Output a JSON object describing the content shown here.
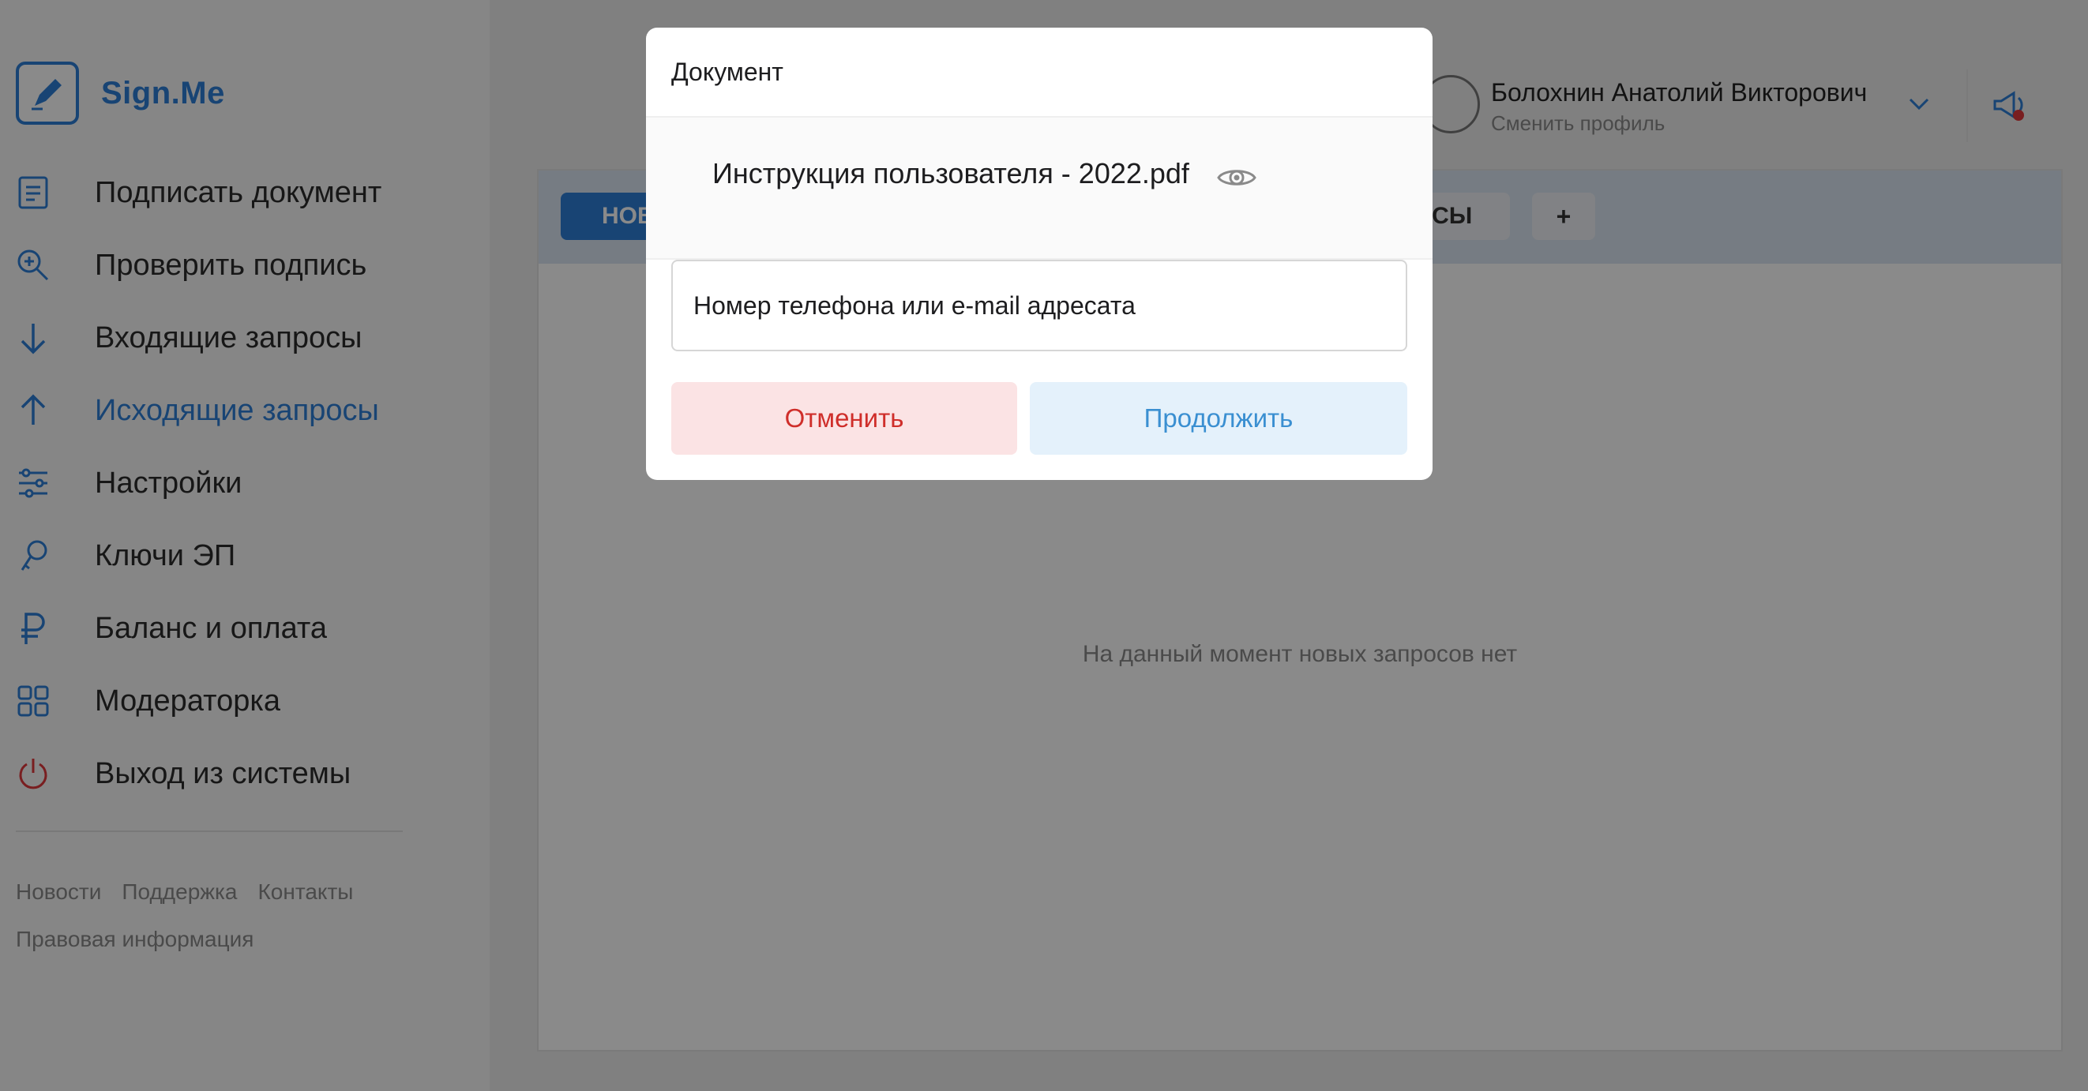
{
  "app": {
    "brand": "Sign.Me"
  },
  "sidebar": {
    "items": [
      {
        "label": "Подписать документ",
        "icon": "document-icon",
        "active": false
      },
      {
        "label": "Проверить подпись",
        "icon": "search-zoom-icon",
        "active": false
      },
      {
        "label": "Входящие запросы",
        "icon": "arrow-down-icon",
        "active": false
      },
      {
        "label": "Исходящие запросы",
        "icon": "arrow-up-icon",
        "active": true
      },
      {
        "label": "Настройки",
        "icon": "sliders-icon",
        "active": false
      },
      {
        "label": "Ключи ЭП",
        "icon": "key-icon",
        "active": false
      },
      {
        "label": "Баланс и оплата",
        "icon": "ruble-icon",
        "active": false
      },
      {
        "label": "Модераторка",
        "icon": "grid-icon",
        "active": false
      },
      {
        "label": "Выход из системы",
        "icon": "power-icon",
        "active": false
      }
    ],
    "footer_links": [
      "Новости",
      "Поддержка",
      "Контакты",
      "Правовая информация"
    ]
  },
  "header": {
    "user_name": "Болохнин Анатолий Викторович",
    "user_action": "Сменить профиль"
  },
  "main": {
    "tabs": [
      "НОВЫЕ",
      "ОСЫ",
      "+"
    ],
    "empty_message": "На данный момент новых запросов нет"
  },
  "modal": {
    "title": "Документ",
    "file_name": "Инструкция пользователя - 2022.pdf",
    "recipient_placeholder": "Номер телефона или e-mail адресата",
    "recipient_value": "",
    "cancel_label": "Отменить",
    "continue_label": "Продолжить"
  },
  "colors": {
    "accent": "#2e7fd6",
    "danger": "#cf2e2a",
    "cancel_bg": "#fbe3e4",
    "continue_bg": "#e4f1fb",
    "overlay": "rgba(0,0,0,0.46)"
  }
}
